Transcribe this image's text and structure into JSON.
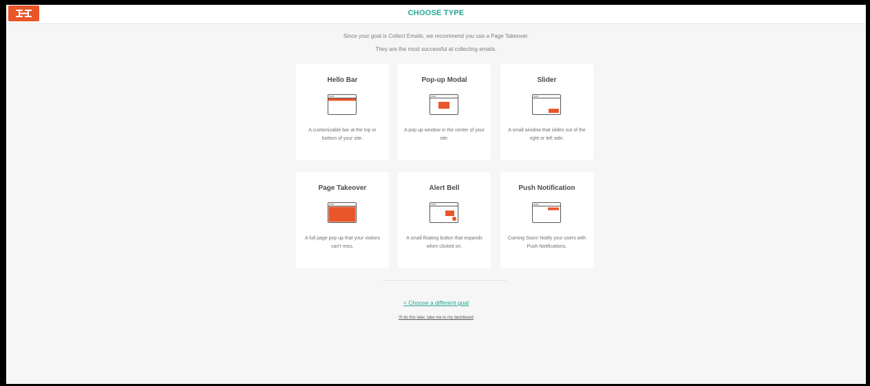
{
  "header": {
    "title": "CHOOSE TYPE",
    "logo_icon": "hellobar-logo-icon",
    "brand_color": "#e8562a",
    "accent_color": "#23a694"
  },
  "intro": {
    "line1": "Since your goal is Collect Emails, we recommend you use a Page Takeover.",
    "line2": "They are the most successful at collecting emails."
  },
  "types": [
    {
      "title": "Hello Bar",
      "description": "A customizable bar at the top or bottom of your site.",
      "icon": "hello-bar-icon"
    },
    {
      "title": "Pop-up Modal",
      "description": "A pop up window in the center of your site.",
      "icon": "popup-modal-icon"
    },
    {
      "title": "Slider",
      "description": "A small window that slides out of the right or left side.",
      "icon": "slider-icon"
    },
    {
      "title": "Page Takeover",
      "description": "A full page pop up that your visitors can't miss.",
      "icon": "page-takeover-icon"
    },
    {
      "title": "Alert Bell",
      "description": "A small floating button that expands when clicked on.",
      "icon": "alert-bell-icon"
    },
    {
      "title": "Push Notification",
      "description": "Coming Soon! Notify your users with Push Notifications.",
      "icon": "push-notification-icon"
    }
  ],
  "footer": {
    "back_link": "<  Choose a different goal",
    "later_link": "I'll do this later, take me to my dashboard"
  }
}
